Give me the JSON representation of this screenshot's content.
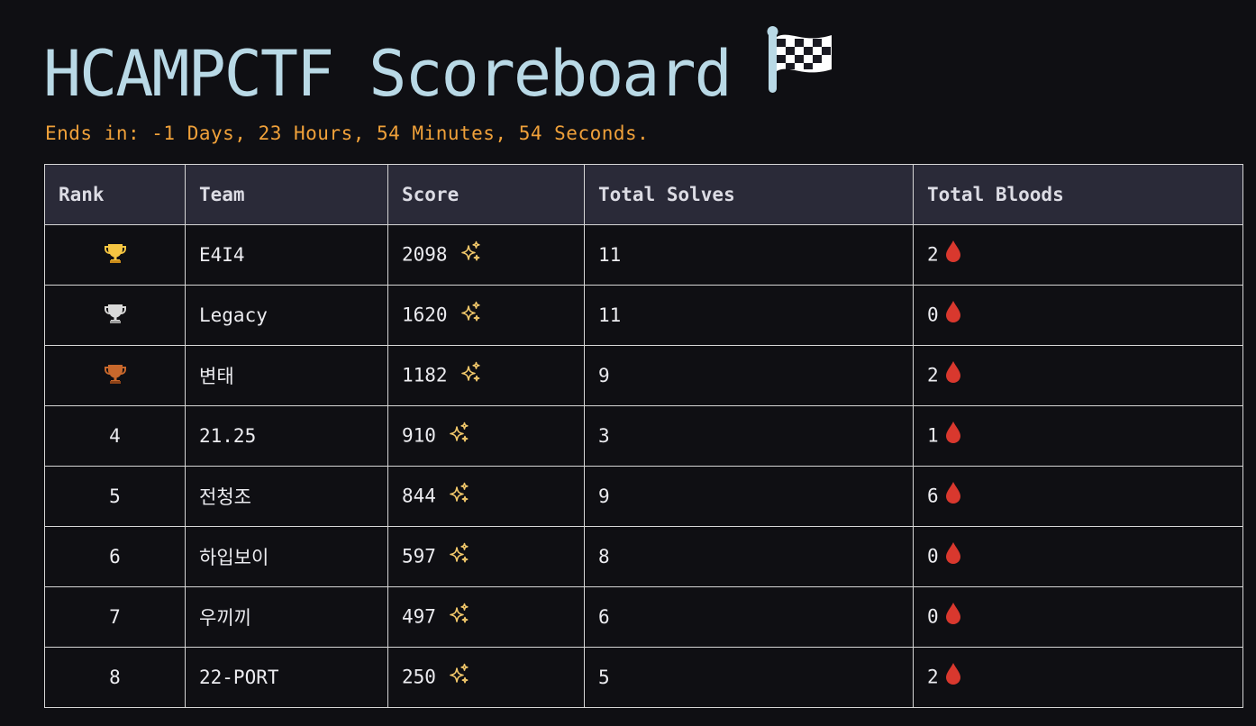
{
  "header": {
    "title": "HCAMPCTF Scoreboard",
    "title_icon": "checkered-flag-icon",
    "countdown": "Ends in: -1 Days, 23 Hours, 54 Minutes, 54 Seconds."
  },
  "table": {
    "columns": [
      "Rank",
      "Team",
      "Score",
      "Total Solves",
      "Total Bloods"
    ],
    "rows": [
      {
        "rank": "",
        "rank_icon": "gold-trophy-icon",
        "team": "E4I4",
        "score": "2098",
        "solves": "11",
        "bloods": "2"
      },
      {
        "rank": "",
        "rank_icon": "silver-trophy-icon",
        "team": "Legacy",
        "score": "1620",
        "solves": "11",
        "bloods": "0"
      },
      {
        "rank": "",
        "rank_icon": "bronze-trophy-icon",
        "team": "변태",
        "score": "1182",
        "solves": "9",
        "bloods": "2"
      },
      {
        "rank": "4",
        "rank_icon": "",
        "team": "21.25",
        "score": "910",
        "solves": "3",
        "bloods": "1"
      },
      {
        "rank": "5",
        "rank_icon": "",
        "team": "전청조",
        "score": "844",
        "solves": "9",
        "bloods": "6"
      },
      {
        "rank": "6",
        "rank_icon": "",
        "team": "하입보이",
        "score": "597",
        "solves": "8",
        "bloods": "0"
      },
      {
        "rank": "7",
        "rank_icon": "",
        "team": "우끼끼",
        "score": "497",
        "solves": "6",
        "bloods": "0"
      },
      {
        "rank": "8",
        "rank_icon": "",
        "team": "22-PORT",
        "score": "250",
        "solves": "5",
        "bloods": "2"
      }
    ],
    "score_icon": "sparkles-icon",
    "bloods_icon": "blood-drop-icon"
  },
  "colors": {
    "background": "#0f0f13",
    "title": "#b9d9e6",
    "countdown": "#f0a13a",
    "header_row": "#2a2a38",
    "gold": "#f5c542",
    "silver": "#d9d9d9",
    "bronze": "#c8682c",
    "blood": "#d9382e",
    "sparkle": "#f3c96b"
  }
}
